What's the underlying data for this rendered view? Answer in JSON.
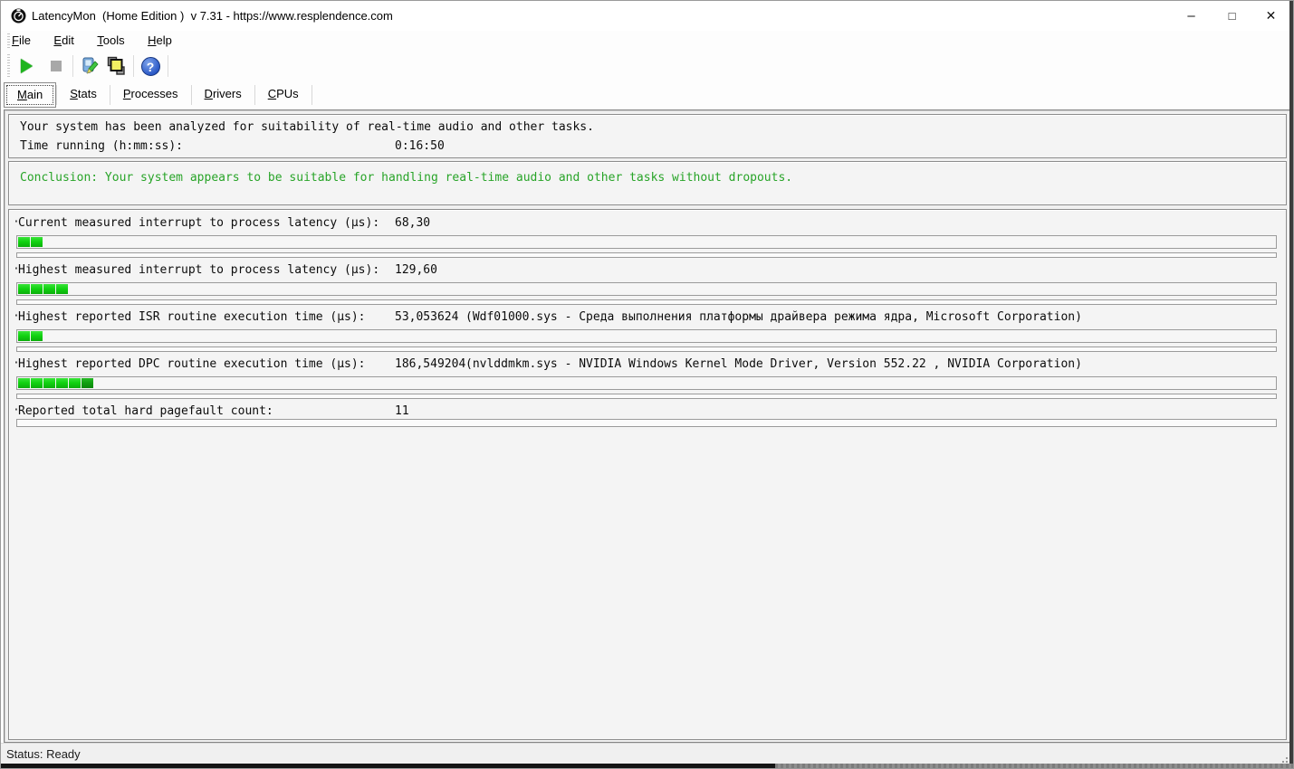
{
  "window": {
    "title": "LatencyMon  (Home Edition )  v 7.31 - https://www.resplendence.com",
    "controls": {
      "minimize": "–",
      "maximize": "□",
      "close": "✕"
    }
  },
  "menu": {
    "items": [
      {
        "label": "File"
      },
      {
        "label": "Edit"
      },
      {
        "label": "Tools"
      },
      {
        "label": "Help"
      }
    ]
  },
  "toolbar": {
    "buttons": [
      {
        "name": "start-monitor",
        "icon": "play-icon"
      },
      {
        "name": "stop-monitor",
        "icon": "stop-icon"
      },
      {
        "name": "edit-options",
        "icon": "tools-icon"
      },
      {
        "name": "copy-report",
        "icon": "copy-icon"
      },
      {
        "name": "help",
        "icon": "help-icon"
      }
    ]
  },
  "tabs": [
    {
      "label": "Main",
      "selected": true
    },
    {
      "label": "Stats",
      "selected": false
    },
    {
      "label": "Processes",
      "selected": false
    },
    {
      "label": "Drivers",
      "selected": false
    },
    {
      "label": "CPUs",
      "selected": false
    }
  ],
  "analysis": {
    "line1": "Your system has been analyzed for suitability of real-time audio and other tasks.",
    "time_label": "Time running (h:mm:ss):",
    "time_value": "0:16:50"
  },
  "conclusion": {
    "text": "Conclusion: Your system appears to be suitable for handling real-time audio and other tasks without dropouts."
  },
  "measurements": [
    {
      "label": "Current measured interrupt to process latency (µs):",
      "value": "68,30",
      "info": "",
      "segments": 2,
      "last_segment_dark": false
    },
    {
      "label": "Highest measured interrupt to process latency (µs):",
      "value": "129,60",
      "info": "",
      "segments": 4,
      "last_segment_dark": false
    },
    {
      "label": "Highest reported ISR routine execution time (µs):",
      "value": "53,053624",
      "info": "(Wdf01000.sys - Среда выполнения платформы драйвера режима ядра, Microsoft Corporation)",
      "segments": 2,
      "last_segment_dark": false
    },
    {
      "label": "Highest reported DPC routine execution time (µs):",
      "value": "186,549204",
      "info": "(nvlddmkm.sys - NVIDIA Windows Kernel Mode Driver, Version 552.22 , NVIDIA Corporation)",
      "segments": 6,
      "last_segment_dark": true
    },
    {
      "label": "Reported total hard pagefault count:",
      "value": "11",
      "info": "",
      "segments": 0,
      "last_segment_dark": false
    }
  ],
  "status_bar": {
    "text": "Status: Ready"
  },
  "ui": {
    "bullet": "·"
  },
  "colors": {
    "seg_green": "#12d312",
    "seg_green_dark": "#12a012",
    "conclusion_green": "#28a428",
    "play_green": "#1eb41e"
  }
}
